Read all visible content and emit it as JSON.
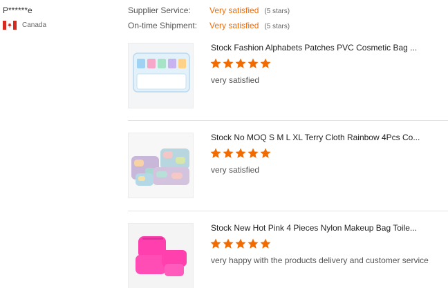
{
  "reviewer": {
    "name": "P******e",
    "country": "Canada"
  },
  "ratings": [
    {
      "label": "Supplier Service:",
      "value": "Very satisfied",
      "stars_text": "(5 stars)"
    },
    {
      "label": "On-time Shipment:",
      "value": "Very satisfied",
      "stars_text": "(5 stars)"
    }
  ],
  "products": [
    {
      "title": "Stock Fashion Alphabets Patches PVC Cosmetic Bag ...",
      "rating": 5,
      "review": "very satisfied",
      "thumb_icon": "clear-pvc-bag-thumbnail"
    },
    {
      "title": "Stock No MOQ S M L XL Terry Cloth Rainbow 4Pcs Co...",
      "rating": 5,
      "review": "very satisfied",
      "thumb_icon": "terry-cloth-bags-thumbnail"
    },
    {
      "title": "Stock New Hot Pink 4 Pieces Nylon Makeup Bag Toile...",
      "rating": 5,
      "review": "very happy with the products delivery and customer service",
      "thumb_icon": "pink-nylon-bags-thumbnail"
    }
  ],
  "colors": {
    "accent": "#f26b00",
    "star": "#f26b00",
    "flag_red": "#d52b1e"
  }
}
